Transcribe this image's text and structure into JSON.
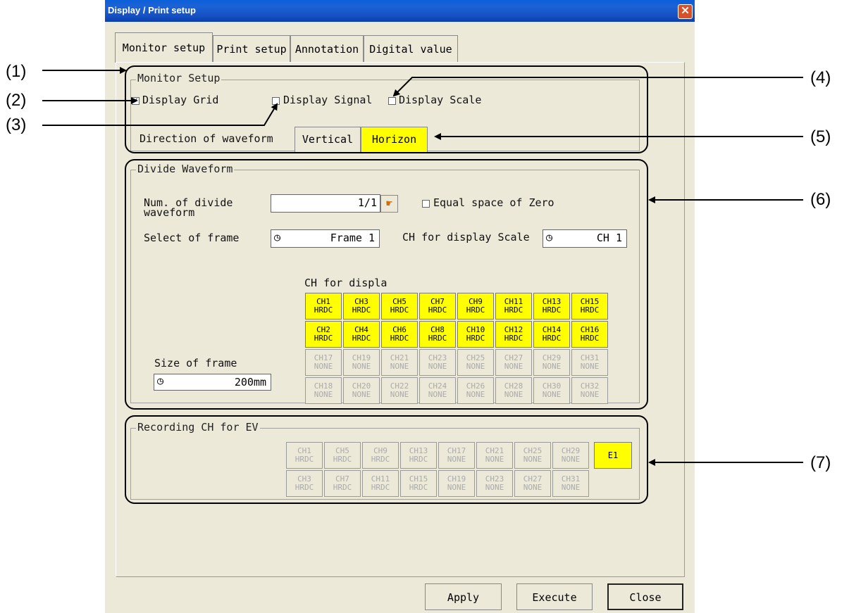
{
  "window": {
    "title": "Display / Print setup",
    "close_glyph": "✕"
  },
  "tabs": [
    {
      "label": "Monitor setup"
    },
    {
      "label": "Print setup"
    },
    {
      "label": "Annotation"
    },
    {
      "label": "Digital value"
    }
  ],
  "monitor_setup": {
    "title": "Monitor Setup",
    "display_grid": {
      "label": "Display Grid",
      "checked": true
    },
    "display_signal": {
      "label": "Display Signal",
      "checked": false
    },
    "display_scale": {
      "label": "Display Scale",
      "checked": false
    },
    "direction_label": "Direction of waveform",
    "vertical_label": "Vertical",
    "horizon_label": "Horizon"
  },
  "divide_waveform": {
    "title": "Divide Waveform",
    "num_divide_label_1": "Num. of divide",
    "num_divide_label_2": "waveform",
    "num_divide_value": "1/1",
    "equal_space_label": "Equal space of Zero",
    "select_frame_label": "Select of frame",
    "select_frame_value": "Frame 1",
    "ch_scale_label": "CH for display Scale",
    "ch_scale_value": "CH 1",
    "ch_display_label": "CH for displa",
    "size_frame_label": "Size of frame",
    "size_frame_value": "200mm",
    "channels": [
      [
        "CH1",
        "HRDC",
        true
      ],
      [
        "CH3",
        "HRDC",
        true
      ],
      [
        "CH5",
        "HRDC",
        true
      ],
      [
        "CH7",
        "HRDC",
        true
      ],
      [
        "CH9",
        "HRDC",
        true
      ],
      [
        "CH11",
        "HRDC",
        true
      ],
      [
        "CH13",
        "HRDC",
        true
      ],
      [
        "CH15",
        "HRDC",
        true
      ],
      [
        "CH2",
        "HRDC",
        true
      ],
      [
        "CH4",
        "HRDC",
        true
      ],
      [
        "CH6",
        "HRDC",
        true
      ],
      [
        "CH8",
        "HRDC",
        true
      ],
      [
        "CH10",
        "HRDC",
        true
      ],
      [
        "CH12",
        "HRDC",
        true
      ],
      [
        "CH14",
        "HRDC",
        true
      ],
      [
        "CH16",
        "HRDC",
        true
      ],
      [
        "CH17",
        "NONE",
        false
      ],
      [
        "CH19",
        "NONE",
        false
      ],
      [
        "CH21",
        "NONE",
        false
      ],
      [
        "CH23",
        "NONE",
        false
      ],
      [
        "CH25",
        "NONE",
        false
      ],
      [
        "CH27",
        "NONE",
        false
      ],
      [
        "CH29",
        "NONE",
        false
      ],
      [
        "CH31",
        "NONE",
        false
      ],
      [
        "CH18",
        "NONE",
        false
      ],
      [
        "CH20",
        "NONE",
        false
      ],
      [
        "CH22",
        "NONE",
        false
      ],
      [
        "CH24",
        "NONE",
        false
      ],
      [
        "CH26",
        "NONE",
        false
      ],
      [
        "CH28",
        "NONE",
        false
      ],
      [
        "CH30",
        "NONE",
        false
      ],
      [
        "CH32",
        "NONE",
        false
      ]
    ]
  },
  "recording_ch": {
    "title": "Recording CH for EV",
    "channels": [
      [
        "CH1",
        "HRDC"
      ],
      [
        "CH5",
        "HRDC"
      ],
      [
        "CH9",
        "HRDC"
      ],
      [
        "CH13",
        "HRDC"
      ],
      [
        "CH17",
        "NONE"
      ],
      [
        "CH21",
        "NONE"
      ],
      [
        "CH25",
        "NONE"
      ],
      [
        "CH29",
        "NONE"
      ],
      [
        "CH3",
        "HRDC"
      ],
      [
        "CH7",
        "HRDC"
      ],
      [
        "CH11",
        "HRDC"
      ],
      [
        "CH15",
        "HRDC"
      ],
      [
        "CH19",
        "NONE"
      ],
      [
        "CH23",
        "NONE"
      ],
      [
        "CH27",
        "NONE"
      ],
      [
        "CH31",
        "NONE"
      ]
    ],
    "e1_label": "E1"
  },
  "buttons": {
    "apply": "Apply",
    "execute": "Execute",
    "close": "Close"
  },
  "annotations": [
    "(1)",
    "(2)",
    "(3)",
    "(4)",
    "(5)",
    "(6)",
    "(7)"
  ],
  "colors": {
    "highlight": "#ffff00",
    "dialog_bg": "#ece9d8",
    "titlebar": "#1652c4"
  }
}
